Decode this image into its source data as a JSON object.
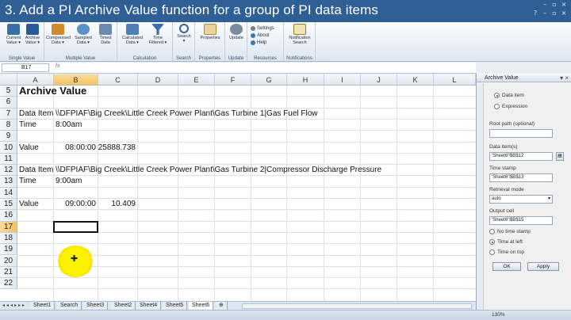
{
  "banner": {
    "title": "3. Add a PI Archive Value function for a group of PI data items"
  },
  "ribbon": {
    "groups": [
      {
        "label": "Single Value",
        "buttons": [
          "Current\nValue ▾",
          "Archive\nValue ▾"
        ]
      },
      {
        "label": "Multiple Value",
        "buttons": [
          "Compressed\nData ▾",
          "Sampled\nData ▾",
          "Timed\nData"
        ]
      },
      {
        "label": "Calculation",
        "buttons": [
          "Calculated\nData ▾",
          "Time\nFiltered ▾"
        ]
      },
      {
        "label": "Search",
        "buttons": [
          "Search\n▾"
        ]
      },
      {
        "label": "Properties",
        "buttons": [
          "Properties"
        ]
      },
      {
        "label": "Update",
        "buttons": [
          "Update"
        ]
      },
      {
        "label": "Resources",
        "small": [
          "Settings",
          "About",
          "Help"
        ]
      },
      {
        "label": "Notifications",
        "buttons": [
          "Notification\nSearch"
        ]
      }
    ]
  },
  "formula_bar": {
    "name_box": "B17",
    "fx": "fx"
  },
  "columns": [
    "A",
    "B",
    "C",
    "D",
    "E",
    "F",
    "G",
    "H",
    "I",
    "J",
    "K",
    "L"
  ],
  "rows": [
    "5",
    "6",
    "7",
    "8",
    "9",
    "10",
    "11",
    "12",
    "13",
    "14",
    "15",
    "16",
    "17",
    "18",
    "19",
    "20",
    "21",
    "22"
  ],
  "cells": {
    "a5": "Archive Value",
    "a7": "Data Item",
    "b7": "\\\\DFPIAF\\Big Creek\\Little Creek Power Plant\\Gas Turbine 1|Gas Fuel Flow",
    "a8": "Time",
    "b8": "8:00am",
    "a10": "Value",
    "b10": "08:00:00",
    "c10": "25888.738",
    "a12": "Data Item",
    "b12": "\\\\DFPIAF\\Big Creek\\Little Creek Power Plant\\Gas Turbine 2|Compressor Discharge Pressure",
    "a13": "Time",
    "b13": "9:00am",
    "a15": "Value",
    "b15": "09:00:00",
    "c15": "10.409"
  },
  "sheet_tabs": [
    "Sheet1",
    "Search",
    "Sheet3",
    "Sheet2",
    "Sheet4",
    "Sheet5",
    "Sheet6"
  ],
  "active_tab": "Sheet6",
  "status": {
    "zoom": "130%"
  },
  "pane": {
    "title": "Archive Value",
    "mode_data_item": "Data item",
    "mode_expression": "Expression",
    "root_path_label": "Root path (optional)",
    "root_path_value": "",
    "data_item_label": "Data item(s)",
    "data_item_value": "'Sheet6'!$B$12",
    "time_stamp_label": "Time stamp",
    "time_stamp_value": "'Sheet6'!$B$13",
    "retrieval_mode_label": "Retrieval mode",
    "retrieval_mode_value": "auto",
    "output_cell_label": "Output cell",
    "output_cell_value": "'Sheet6'!$B$15",
    "opt_no_time_stamp": "No time stamp",
    "opt_time_at_left": "Time at left",
    "opt_time_on_top": "Time on top",
    "ok_label": "OK",
    "apply_label": "Apply"
  },
  "colors": {
    "banner": "#2f5f94",
    "selected_header": "#f3c363",
    "cursor_highlight": "#fff200"
  },
  "icons": [
    "current-value-icon",
    "archive-value-icon",
    "compressed-data-icon",
    "sampled-data-icon",
    "timed-data-icon",
    "calculated-data-icon",
    "time-filtered-icon",
    "search-icon",
    "properties-icon",
    "update-icon",
    "notification-search-icon",
    "close-icon"
  ]
}
